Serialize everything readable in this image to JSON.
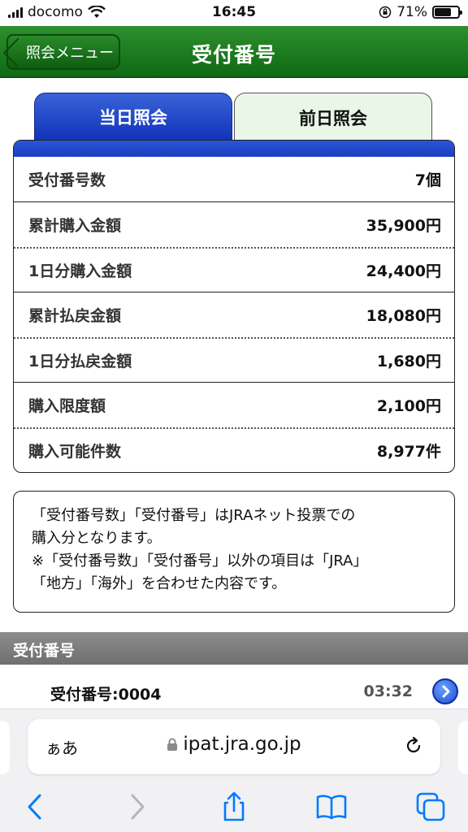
{
  "status_bar": {
    "carrier": "docomo",
    "time": "16:45",
    "battery": "71%",
    "battery_level": 0.71
  },
  "header": {
    "back_label": "照会メニュー",
    "title": "受付番号"
  },
  "tabs": [
    {
      "label": "当日照会",
      "active": true
    },
    {
      "label": "前日照会",
      "active": false
    }
  ],
  "summary": {
    "groups": [
      [
        {
          "label": "受付番号数",
          "value": "7個"
        }
      ],
      [
        {
          "label": "累計購入金額",
          "value": "35,900円"
        },
        {
          "label": "1日分購入金額",
          "value": "24,400円"
        }
      ],
      [
        {
          "label": "累計払戻金額",
          "value": "18,080円"
        },
        {
          "label": "1日分払戻金額",
          "value": "1,680円"
        }
      ],
      [
        {
          "label": "購入限度額",
          "value": "2,100円"
        },
        {
          "label": "購入可能件数",
          "value": "8,977件"
        }
      ]
    ]
  },
  "note": {
    "line1": "「受付番号数」「受付番号」はJRAネット投票での",
    "line2": "購入分となります。",
    "line3": "※「受付番号数」「受付番号」以外の項目は「JRA」",
    "line4": "「地方」「海外」を合わせた内容です。"
  },
  "section": {
    "title": "受付番号",
    "items": [
      {
        "label": "受付番号:0004",
        "time": "03:32"
      }
    ]
  },
  "browser": {
    "aa": "ぁあ",
    "url": "ipat.jra.go.jp"
  },
  "colors": {
    "header_green": "#0f6a14",
    "tab_blue": "#1133b8",
    "link_blue": "#007aff"
  }
}
